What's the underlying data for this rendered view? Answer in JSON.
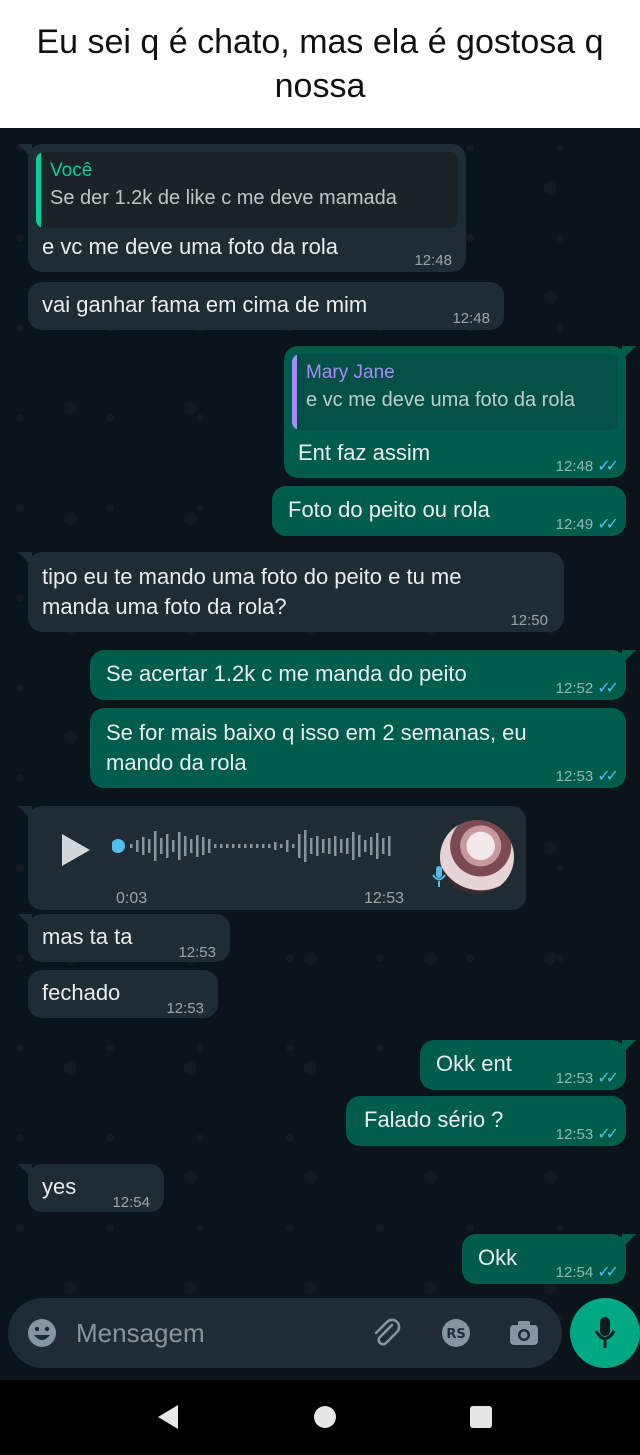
{
  "caption": "Eu sei q é chato, mas ela é gostosa q nossa",
  "messages": {
    "m1": {
      "quote_author": "Você",
      "quote_text": "Se der 1.2k de like c me deve mamada",
      "text": "e vc me deve uma foto da rola",
      "time": "12:48"
    },
    "m2": {
      "text": "vai ganhar fama em cima de mim",
      "time": "12:48"
    },
    "m3": {
      "quote_author": "Mary Jane",
      "quote_text": "e vc me deve uma foto da rola",
      "text": "Ent faz assim",
      "time": "12:48"
    },
    "m4": {
      "text": "Foto do peito ou rola",
      "time": "12:49"
    },
    "m5": {
      "line1": "tipo eu te mando uma foto do peito e tu me",
      "line2": "manda uma foto da rola?",
      "time": "12:50"
    },
    "m6": {
      "text": "Se acertar 1.2k c me manda do peito",
      "time": "12:52"
    },
    "m7": {
      "line1": "Se for mais baixo q isso em 2 semanas, eu",
      "line2": "mando da rola",
      "time": "12:53"
    },
    "m8": {
      "duration": "0:03",
      "time": "12:53"
    },
    "m9": {
      "text": "mas ta ta",
      "time": "12:53"
    },
    "m10": {
      "text": "fechado",
      "time": "12:53"
    },
    "m11": {
      "text": "Okk ent",
      "time": "12:53"
    },
    "m12": {
      "text": "Falado sério ?",
      "time": "12:53"
    },
    "m13": {
      "text": "yes",
      "time": "12:54"
    },
    "m14": {
      "text": "Okk",
      "time": "12:54"
    }
  },
  "input": {
    "placeholder": "Mensagem",
    "rs_label": "RS"
  },
  "icons": {
    "emoji": "emoji-icon",
    "attach": "paperclip-icon",
    "payment": "rs-payment-icon",
    "camera": "camera-icon",
    "mic": "microphone-icon",
    "play": "play-icon",
    "read": "double-check-icon",
    "back": "nav-back-icon",
    "home": "nav-home-icon",
    "recent": "nav-recents-icon"
  },
  "colors": {
    "incoming": "#202c33",
    "outgoing": "#005c4b",
    "accent": "#00a884",
    "read_ticks": "#53bdeb",
    "background": "#0b141a"
  }
}
